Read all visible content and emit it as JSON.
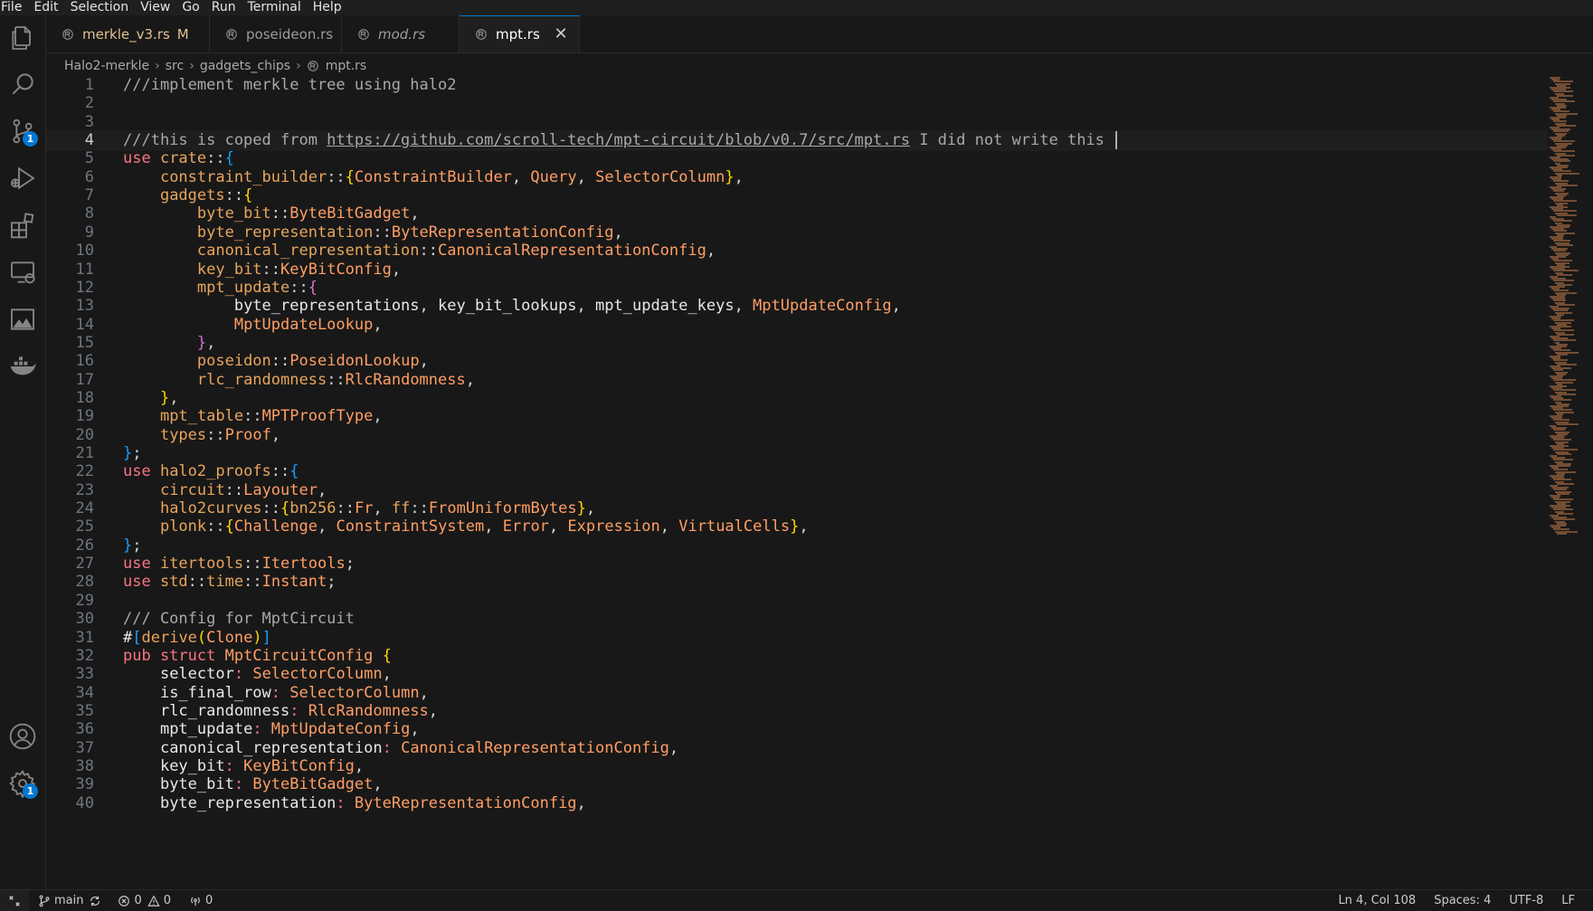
{
  "menubar": {
    "items": [
      "File",
      "Edit",
      "Selection",
      "View",
      "Go",
      "Run",
      "Terminal",
      "Help"
    ]
  },
  "activitybar": {
    "icons": [
      "explorer-icon",
      "search-icon",
      "source-control-icon",
      "run-debug-icon",
      "extensions-icon",
      "remote-explorer-icon",
      "image-preview-icon",
      "docker-icon",
      "account-icon",
      "settings-gear-icon"
    ],
    "source_control_badge": "1",
    "settings_badge": "1"
  },
  "tabs": [
    {
      "label": "merkle_v3.rs",
      "modified": "M",
      "icon": "rust-file-icon"
    },
    {
      "label": "poseideon.rs",
      "icon": "rust-file-icon"
    },
    {
      "label": "mod.rs",
      "icon": "rust-file-icon"
    },
    {
      "label": "mpt.rs",
      "icon": "rust-file-icon",
      "close": "✕"
    }
  ],
  "breadcrumb": [
    "Halo2-merkle",
    "src",
    "gadgets_chips",
    "mpt.rs"
  ],
  "editor": {
    "current_line": 4,
    "lines": [
      {
        "n": "1",
        "t": [
          [
            "c",
            "///implement merkle tree using halo2"
          ]
        ]
      },
      {
        "n": "2",
        "t": []
      },
      {
        "n": "3",
        "t": []
      },
      {
        "n": "4",
        "t": [
          [
            "c",
            "///this is coped from "
          ],
          [
            "l",
            "https://github.com/scroll-tech/mpt-circuit/blob/v0.7/src/mpt.rs"
          ],
          [
            "c",
            " I did not write this "
          ]
        ],
        "cursor": true
      },
      {
        "n": "5",
        "t": [
          [
            "k",
            "use "
          ],
          [
            "m",
            "crate"
          ],
          [
            "p",
            "::"
          ],
          [
            "b3",
            "{"
          ]
        ]
      },
      {
        "n": "6",
        "t": [
          [
            "p",
            "    "
          ],
          [
            "m",
            "constraint_builder"
          ],
          [
            "p",
            "::"
          ],
          [
            "b1",
            "{"
          ],
          [
            "y",
            "ConstraintBuilder"
          ],
          [
            "p",
            ", "
          ],
          [
            "y",
            "Query"
          ],
          [
            "p",
            ", "
          ],
          [
            "y",
            "SelectorColumn"
          ],
          [
            "b1",
            "}"
          ],
          [
            "p",
            ","
          ]
        ]
      },
      {
        "n": "7",
        "t": [
          [
            "p",
            "    "
          ],
          [
            "m",
            "gadgets"
          ],
          [
            "p",
            "::"
          ],
          [
            "b1",
            "{"
          ]
        ]
      },
      {
        "n": "8",
        "t": [
          [
            "p",
            "        "
          ],
          [
            "m",
            "byte_bit"
          ],
          [
            "p",
            "::"
          ],
          [
            "y",
            "ByteBitGadget"
          ],
          [
            "p",
            ","
          ]
        ]
      },
      {
        "n": "9",
        "t": [
          [
            "p",
            "        "
          ],
          [
            "m",
            "byte_representation"
          ],
          [
            "p",
            "::"
          ],
          [
            "y",
            "ByteRepresentationConfig"
          ],
          [
            "p",
            ","
          ]
        ]
      },
      {
        "n": "10",
        "t": [
          [
            "p",
            "        "
          ],
          [
            "m",
            "canonical_representation"
          ],
          [
            "p",
            "::"
          ],
          [
            "y",
            "CanonicalRepresentationConfig"
          ],
          [
            "p",
            ","
          ]
        ]
      },
      {
        "n": "11",
        "t": [
          [
            "p",
            "        "
          ],
          [
            "m",
            "key_bit"
          ],
          [
            "p",
            "::"
          ],
          [
            "y",
            "KeyBitConfig"
          ],
          [
            "p",
            ","
          ]
        ]
      },
      {
        "n": "12",
        "t": [
          [
            "p",
            "        "
          ],
          [
            "m",
            "mpt_update"
          ],
          [
            "p",
            "::"
          ],
          [
            "b2",
            "{"
          ]
        ]
      },
      {
        "n": "13",
        "t": [
          [
            "p",
            "            "
          ],
          [
            "w",
            "byte_representations"
          ],
          [
            "p",
            ", "
          ],
          [
            "w",
            "key_bit_lookups"
          ],
          [
            "p",
            ", "
          ],
          [
            "w",
            "mpt_update_keys"
          ],
          [
            "p",
            ", "
          ],
          [
            "y",
            "MptUpdateConfig"
          ],
          [
            "p",
            ","
          ]
        ]
      },
      {
        "n": "14",
        "t": [
          [
            "p",
            "            "
          ],
          [
            "y",
            "MptUpdateLookup"
          ],
          [
            "p",
            ","
          ]
        ]
      },
      {
        "n": "15",
        "t": [
          [
            "p",
            "        "
          ],
          [
            "b2",
            "}"
          ],
          [
            "p",
            ","
          ]
        ]
      },
      {
        "n": "16",
        "t": [
          [
            "p",
            "        "
          ],
          [
            "m",
            "poseidon"
          ],
          [
            "p",
            "::"
          ],
          [
            "y",
            "PoseidonLookup"
          ],
          [
            "p",
            ","
          ]
        ]
      },
      {
        "n": "17",
        "t": [
          [
            "p",
            "        "
          ],
          [
            "m",
            "rlc_randomness"
          ],
          [
            "p",
            "::"
          ],
          [
            "y",
            "RlcRandomness"
          ],
          [
            "p",
            ","
          ]
        ]
      },
      {
        "n": "18",
        "t": [
          [
            "p",
            "    "
          ],
          [
            "b1",
            "}"
          ],
          [
            "p",
            ","
          ]
        ]
      },
      {
        "n": "19",
        "t": [
          [
            "p",
            "    "
          ],
          [
            "m",
            "mpt_table"
          ],
          [
            "p",
            "::"
          ],
          [
            "y",
            "MPTProofType"
          ],
          [
            "p",
            ","
          ]
        ]
      },
      {
        "n": "20",
        "t": [
          [
            "p",
            "    "
          ],
          [
            "m",
            "types"
          ],
          [
            "p",
            "::"
          ],
          [
            "y",
            "Proof"
          ],
          [
            "p",
            ","
          ]
        ]
      },
      {
        "n": "21",
        "t": [
          [
            "b3",
            "}"
          ],
          [
            "p",
            ";"
          ]
        ]
      },
      {
        "n": "22",
        "t": [
          [
            "k",
            "use "
          ],
          [
            "m",
            "halo2_proofs"
          ],
          [
            "p",
            "::"
          ],
          [
            "b3",
            "{"
          ]
        ]
      },
      {
        "n": "23",
        "t": [
          [
            "p",
            "    "
          ],
          [
            "m",
            "circuit"
          ],
          [
            "p",
            "::"
          ],
          [
            "y",
            "Layouter"
          ],
          [
            "p",
            ","
          ]
        ]
      },
      {
        "n": "24",
        "t": [
          [
            "p",
            "    "
          ],
          [
            "m",
            "halo2curves"
          ],
          [
            "p",
            "::"
          ],
          [
            "b1",
            "{"
          ],
          [
            "m",
            "bn256"
          ],
          [
            "p",
            "::"
          ],
          [
            "y",
            "Fr"
          ],
          [
            "p",
            ", "
          ],
          [
            "m",
            "ff"
          ],
          [
            "p",
            "::"
          ],
          [
            "y",
            "FromUniformBytes"
          ],
          [
            "b1",
            "}"
          ],
          [
            "p",
            ","
          ]
        ]
      },
      {
        "n": "25",
        "t": [
          [
            "p",
            "    "
          ],
          [
            "m",
            "plonk"
          ],
          [
            "p",
            "::"
          ],
          [
            "b1",
            "{"
          ],
          [
            "y",
            "Challenge"
          ],
          [
            "p",
            ", "
          ],
          [
            "y",
            "ConstraintSystem"
          ],
          [
            "p",
            ", "
          ],
          [
            "y",
            "Error"
          ],
          [
            "p",
            ", "
          ],
          [
            "y",
            "Expression"
          ],
          [
            "p",
            ", "
          ],
          [
            "y",
            "VirtualCells"
          ],
          [
            "b1",
            "}"
          ],
          [
            "p",
            ","
          ]
        ]
      },
      {
        "n": "26",
        "t": [
          [
            "b3",
            "}"
          ],
          [
            "p",
            ";"
          ]
        ]
      },
      {
        "n": "27",
        "t": [
          [
            "k",
            "use "
          ],
          [
            "m",
            "itertools"
          ],
          [
            "p",
            "::"
          ],
          [
            "y",
            "Itertools"
          ],
          [
            "p",
            ";"
          ]
        ]
      },
      {
        "n": "28",
        "t": [
          [
            "k",
            "use "
          ],
          [
            "m",
            "std"
          ],
          [
            "p",
            "::"
          ],
          [
            "m",
            "time"
          ],
          [
            "p",
            "::"
          ],
          [
            "y",
            "Instant"
          ],
          [
            "p",
            ";"
          ]
        ]
      },
      {
        "n": "29",
        "t": []
      },
      {
        "n": "30",
        "t": [
          [
            "c",
            "/// Config for MptCircuit"
          ]
        ]
      },
      {
        "n": "31",
        "t": [
          [
            "w",
            "#"
          ],
          [
            "b3",
            "["
          ],
          [
            "m",
            "derive"
          ],
          [
            "b1",
            "("
          ],
          [
            "y",
            "Clone"
          ],
          [
            "b1",
            ")"
          ],
          [
            "b3",
            "]"
          ]
        ]
      },
      {
        "n": "32",
        "t": [
          [
            "k",
            "pub struct "
          ],
          [
            "y",
            "MptCircuitConfig"
          ],
          [
            "p",
            " "
          ],
          [
            "b1",
            "{"
          ]
        ]
      },
      {
        "n": "33",
        "t": [
          [
            "p",
            "    "
          ],
          [
            "w",
            "selector"
          ],
          [
            "k",
            ": "
          ],
          [
            "y",
            "SelectorColumn"
          ],
          [
            "p",
            ","
          ]
        ]
      },
      {
        "n": "34",
        "t": [
          [
            "p",
            "    "
          ],
          [
            "w",
            "is_final_row"
          ],
          [
            "k",
            ": "
          ],
          [
            "y",
            "SelectorColumn"
          ],
          [
            "p",
            ","
          ]
        ]
      },
      {
        "n": "35",
        "t": [
          [
            "p",
            "    "
          ],
          [
            "w",
            "rlc_randomness"
          ],
          [
            "k",
            ": "
          ],
          [
            "y",
            "RlcRandomness"
          ],
          [
            "p",
            ","
          ]
        ]
      },
      {
        "n": "36",
        "t": [
          [
            "p",
            "    "
          ],
          [
            "w",
            "mpt_update"
          ],
          [
            "k",
            ": "
          ],
          [
            "y",
            "MptUpdateConfig"
          ],
          [
            "p",
            ","
          ]
        ]
      },
      {
        "n": "37",
        "t": [
          [
            "p",
            "    "
          ],
          [
            "w",
            "canonical_representation"
          ],
          [
            "k",
            ": "
          ],
          [
            "y",
            "CanonicalRepresentationConfig"
          ],
          [
            "p",
            ","
          ]
        ]
      },
      {
        "n": "38",
        "t": [
          [
            "p",
            "    "
          ],
          [
            "w",
            "key_bit"
          ],
          [
            "k",
            ": "
          ],
          [
            "y",
            "KeyBitConfig"
          ],
          [
            "p",
            ","
          ]
        ]
      },
      {
        "n": "39",
        "t": [
          [
            "p",
            "    "
          ],
          [
            "w",
            "byte_bit"
          ],
          [
            "k",
            ": "
          ],
          [
            "y",
            "ByteBitGadget"
          ],
          [
            "p",
            ","
          ]
        ]
      },
      {
        "n": "40",
        "t": [
          [
            "p",
            "    "
          ],
          [
            "w",
            "byte_representation"
          ],
          [
            "k",
            ": "
          ],
          [
            "y",
            "ByteRepresentationConfig"
          ],
          [
            "p",
            ","
          ]
        ]
      }
    ]
  },
  "statusbar": {
    "branch": "main",
    "errors": "0",
    "warnings": "0",
    "ports": "0",
    "position": "Ln 4, Col 108",
    "spaces": "Spaces: 4",
    "encoding": "UTF-8",
    "eol": "LF"
  },
  "colors": {
    "accent": "#0078d4",
    "keyword": "#f97583",
    "type": "#ff9e64",
    "module": "#e8a55c",
    "comment": "#a9a9a9",
    "modified": "#e2c08d"
  }
}
